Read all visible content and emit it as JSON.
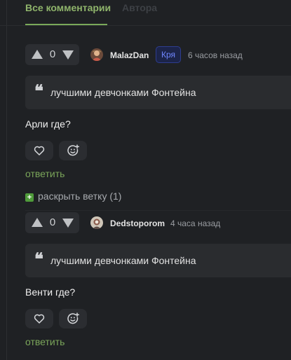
{
  "tabs": {
    "active": "Все комментарии",
    "inactive": "Автора"
  },
  "comments": [
    {
      "username": "MalazDan",
      "badge": "Кря",
      "time": "6 часов назад",
      "votes": "0",
      "quote_mark": "❝",
      "quote": "лучшими девчонками Фонтейна",
      "text": "Арли где?",
      "reply": "ответить"
    },
    {
      "username": "Dedstoporom",
      "time": "4 часа назад",
      "votes": "0",
      "quote_mark": "❝",
      "quote": "лучшими девчонками Фонтейна",
      "text": "Венти где?",
      "reply": "ответить"
    }
  ],
  "expand": {
    "icon": "+",
    "label": "раскрыть ветку (1)"
  },
  "colors": {
    "accent": "#7ba65a",
    "badge": "#6f86ff",
    "background": "#1f2124"
  },
  "icons": [
    "upvote-icon",
    "downvote-icon",
    "heart-icon",
    "add-reaction-icon",
    "expand-plus-icon"
  ]
}
